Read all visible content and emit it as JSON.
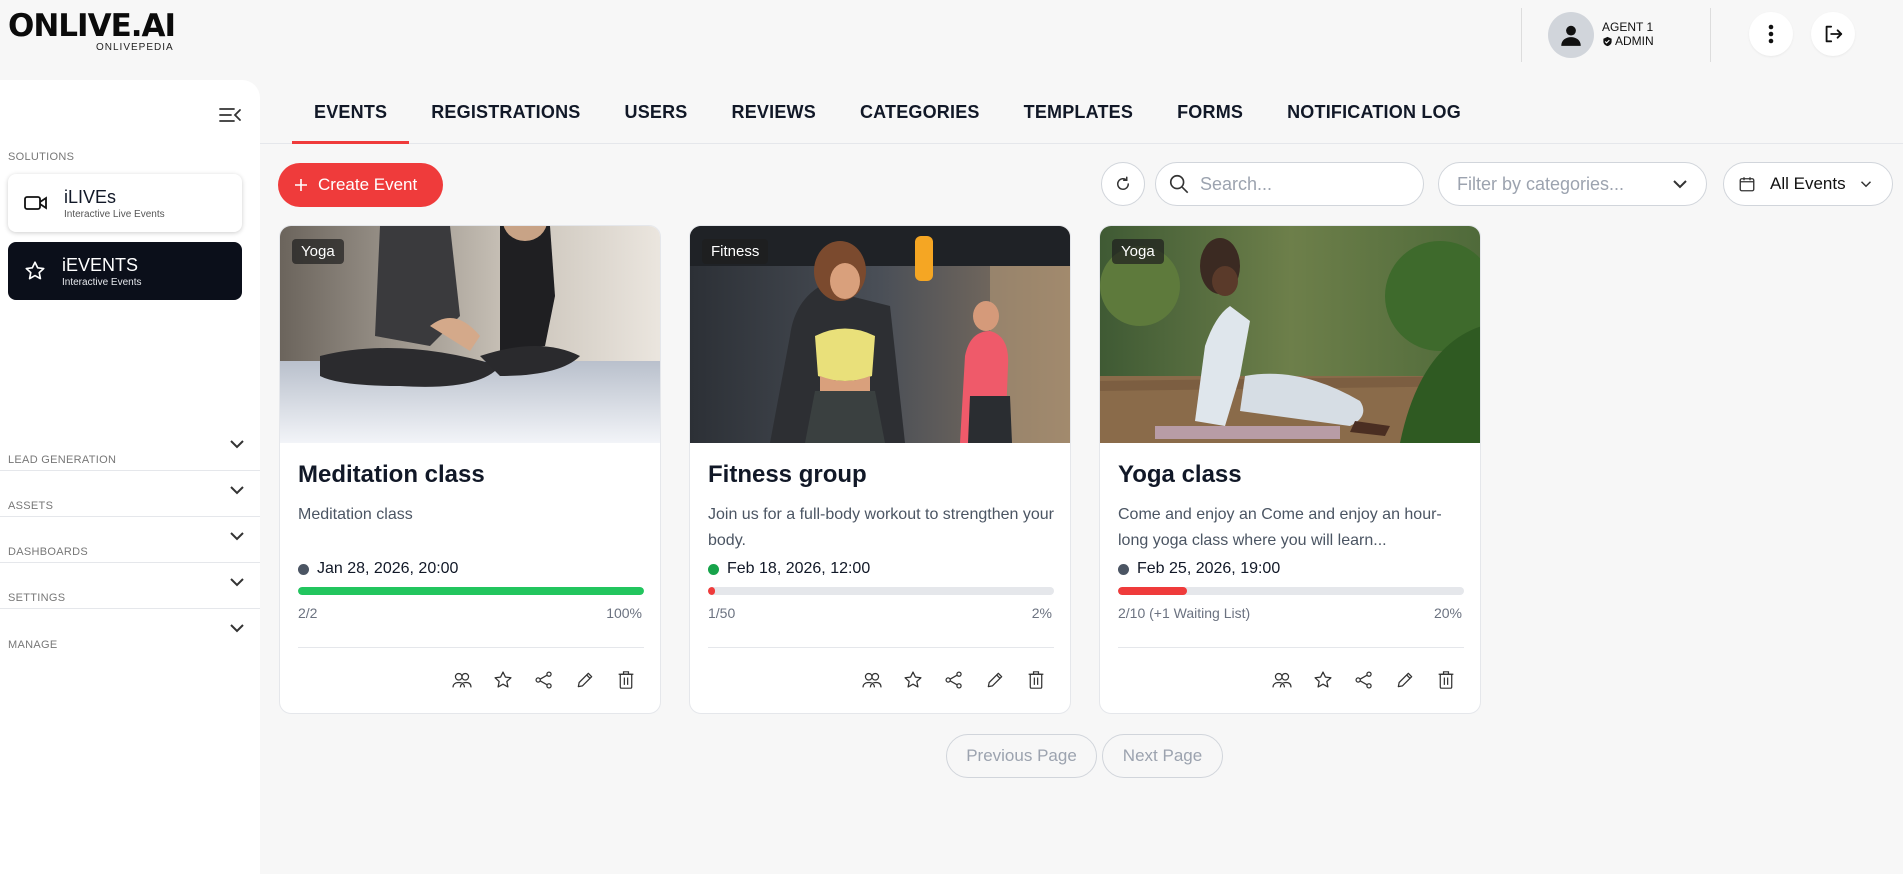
{
  "brand": {
    "name": "ONLIVE.AI",
    "sub": "ONLIVEPEDIA"
  },
  "user": {
    "name": "AGENT 1",
    "role": "ADMIN"
  },
  "sidebar": {
    "solutions_label": "SOLUTIONS",
    "solutions": [
      {
        "title": "iLIVEs",
        "subtitle": "Interactive Live Events",
        "icon": "video-camera-icon"
      },
      {
        "title": "iEVENTS",
        "subtitle": "Interactive Events",
        "icon": "star-icon"
      }
    ],
    "menu": [
      "LEAD GENERATION",
      "ASSETS",
      "DASHBOARDS",
      "SETTINGS",
      "MANAGE"
    ]
  },
  "tabs": [
    "EVENTS",
    "REGISTRATIONS",
    "USERS",
    "REVIEWS",
    "CATEGORIES",
    "TEMPLATES",
    "FORMS",
    "NOTIFICATION LOG"
  ],
  "active_tab": "EVENTS",
  "toolbar": {
    "create_label": "Create Event",
    "search_placeholder": "Search...",
    "filter_placeholder": "Filter by categories...",
    "events_select": "All Events"
  },
  "colors": {
    "accent": "#ef3b3b",
    "success": "#22c55e",
    "dark": "#0b0f1a"
  },
  "events": [
    {
      "category": "Yoga",
      "title": "Meditation class",
      "description": "Meditation class",
      "date": "Jan 28, 2026, 20:00",
      "status_color": "#4b5563",
      "count": "2/2",
      "percent": "100%",
      "fill": 1.0,
      "fill_color": "#22c55e"
    },
    {
      "category": "Fitness",
      "title": "Fitness group",
      "description": "Join us for a full-body workout to strengthen your body.",
      "date": "Feb 18, 2026, 12:00",
      "status_color": "#16a34a",
      "count": "1/50",
      "percent": "2%",
      "fill": 0.02,
      "fill_color": "#ef3b3b"
    },
    {
      "category": "Yoga",
      "title": "Yoga class",
      "description": "Come and enjoy an Come and enjoy an hour-long yoga class where you will learn...",
      "date": "Feb 25, 2026, 19:00",
      "status_color": "#4b5563",
      "count": "2/10 (+1 Waiting List)",
      "percent": "20%",
      "fill": 0.2,
      "fill_color": "#ef3b3b"
    }
  ],
  "pagination": {
    "prev": "Previous Page",
    "next": "Next Page"
  }
}
